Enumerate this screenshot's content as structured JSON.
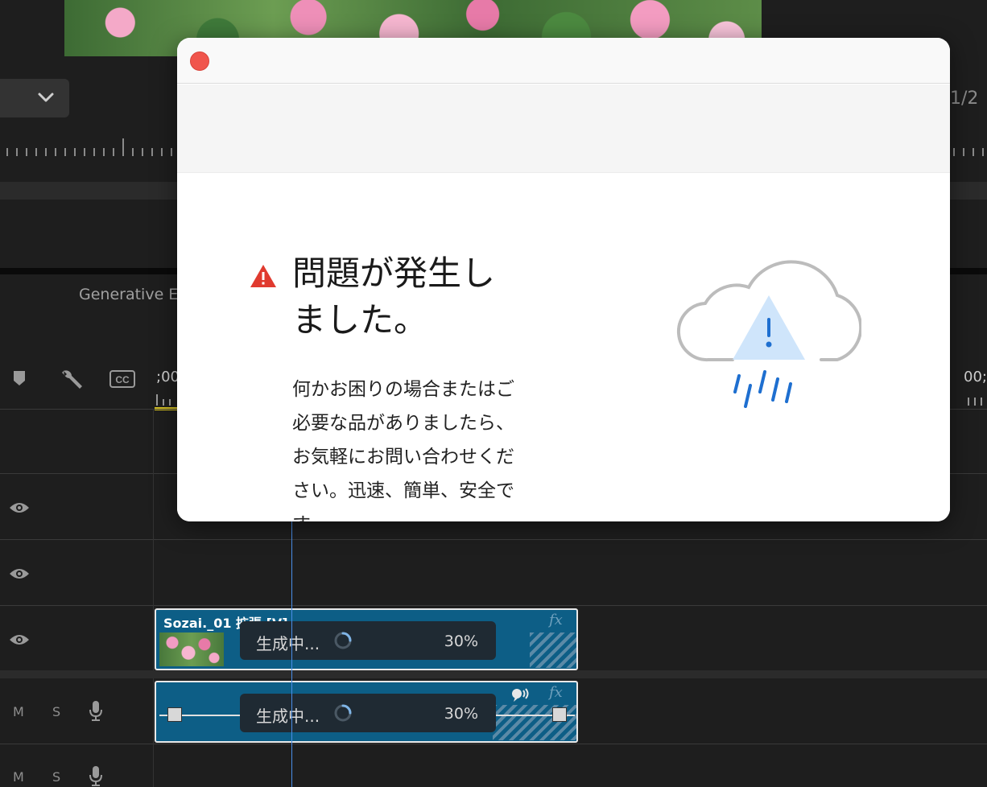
{
  "monitor": {
    "page_fraction": "1/2"
  },
  "panel": {
    "tab_label": "Generative E"
  },
  "timeline": {
    "timecode_left": ";00",
    "timecode_right": "00;",
    "track_m_label": "M",
    "track_s_label": "S"
  },
  "clips": {
    "video": {
      "title": "Sozai._01 拡張 [V]",
      "fx_label": "fx",
      "status_text": "生成中...",
      "progress_text": "30%"
    },
    "audio": {
      "fx_label": "fx",
      "status_text": "生成中...",
      "progress_text": "30%"
    }
  },
  "dialog": {
    "title": "問題が発生しました。",
    "body": "何かお困りの場合またはご必要な品がありましたら、お気軽にお問い合わせください。迅速、簡単、安全です。"
  },
  "colors": {
    "clip_blue": "#0d5e86",
    "close_red": "#f0554c",
    "warning_red": "#e03a2f",
    "playhead_blue": "#4a8ee8",
    "cloud_accent": "#1e6fd0"
  },
  "icons": {
    "close": "close-dot-icon",
    "warning": "warning-triangle-icon",
    "illustration": "cloud-rain-warning-icon"
  }
}
